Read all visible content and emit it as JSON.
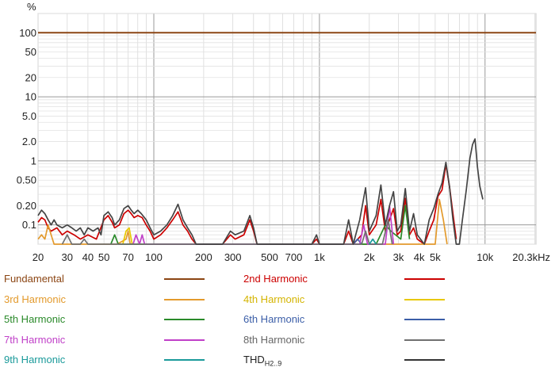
{
  "chart_data": {
    "type": "line",
    "y_unit_label": "%",
    "x_unit_label": "kHz",
    "x_scale": "log",
    "y_scale": "log",
    "xlim": [
      20,
      20300
    ],
    "ylim": [
      0.05,
      200
    ],
    "grid": true,
    "x_ticks": [
      {
        "v": 20,
        "label": "20"
      },
      {
        "v": 30,
        "label": "30"
      },
      {
        "v": 40,
        "label": "40"
      },
      {
        "v": 50,
        "label": "50"
      },
      {
        "v": 70,
        "label": "70"
      },
      {
        "v": 100,
        "label": "100"
      },
      {
        "v": 200,
        "label": "200"
      },
      {
        "v": 300,
        "label": "300"
      },
      {
        "v": 500,
        "label": "500"
      },
      {
        "v": 700,
        "label": "700"
      },
      {
        "v": 1000,
        "label": "1k"
      },
      {
        "v": 2000,
        "label": "2k"
      },
      {
        "v": 3000,
        "label": "3k"
      },
      {
        "v": 4000,
        "label": "4k"
      },
      {
        "v": 5000,
        "label": "5k"
      },
      {
        "v": 10000,
        "label": "10k"
      },
      {
        "v": 20300,
        "label": "20.3"
      }
    ],
    "y_ticks": [
      {
        "v": 100,
        "label": "100"
      },
      {
        "v": 50,
        "label": "50"
      },
      {
        "v": 20,
        "label": "20"
      },
      {
        "v": 10,
        "label": "10"
      },
      {
        "v": 5,
        "label": "5.0"
      },
      {
        "v": 2,
        "label": "2.0"
      },
      {
        "v": 1,
        "label": "1"
      },
      {
        "v": 0.5,
        "label": "0.50"
      },
      {
        "v": 0.2,
        "label": "0.20"
      },
      {
        "v": 0.1,
        "label": "0.1"
      }
    ],
    "series": [
      {
        "name": "Fundamental",
        "color": "#8b4513",
        "points": [
          [
            20,
            100
          ],
          [
            20300,
            100
          ]
        ]
      },
      {
        "name": "2nd Harmonic",
        "color": "#cc0000",
        "points": [
          [
            20,
            0.11
          ],
          [
            21,
            0.13
          ],
          [
            22,
            0.12
          ],
          [
            23,
            0.09
          ],
          [
            24,
            0.08
          ],
          [
            26,
            0.09
          ],
          [
            28,
            0.07
          ],
          [
            30,
            0.08
          ],
          [
            33,
            0.07
          ],
          [
            36,
            0.06
          ],
          [
            40,
            0.07
          ],
          [
            45,
            0.06
          ],
          [
            50,
            0.12
          ],
          [
            53,
            0.14
          ],
          [
            56,
            0.11
          ],
          [
            58,
            0.09
          ],
          [
            62,
            0.1
          ],
          [
            66,
            0.15
          ],
          [
            70,
            0.17
          ],
          [
            73,
            0.15
          ],
          [
            76,
            0.13
          ],
          [
            80,
            0.14
          ],
          [
            85,
            0.13
          ],
          [
            90,
            0.1
          ],
          [
            95,
            0.08
          ],
          [
            100,
            0.06
          ],
          [
            110,
            0.07
          ],
          [
            120,
            0.09
          ],
          [
            130,
            0.12
          ],
          [
            140,
            0.16
          ],
          [
            150,
            0.1
          ],
          [
            160,
            0.08
          ],
          [
            170,
            0.06
          ],
          [
            180,
            0.05
          ],
          [
            260,
            0.05
          ],
          [
            290,
            0.07
          ],
          [
            310,
            0.06
          ],
          [
            350,
            0.07
          ],
          [
            380,
            0.12
          ],
          [
            400,
            0.08
          ],
          [
            420,
            0.05
          ],
          [
            900,
            0.05
          ],
          [
            960,
            0.06
          ],
          [
            1000,
            0.05
          ],
          [
            1400,
            0.05
          ],
          [
            1500,
            0.08
          ],
          [
            1600,
            0.05
          ],
          [
            1800,
            0.07
          ],
          [
            1900,
            0.2
          ],
          [
            2000,
            0.07
          ],
          [
            2200,
            0.1
          ],
          [
            2350,
            0.25
          ],
          [
            2500,
            0.08
          ],
          [
            2650,
            0.12
          ],
          [
            2800,
            0.18
          ],
          [
            2950,
            0.07
          ],
          [
            3100,
            0.08
          ],
          [
            3300,
            0.26
          ],
          [
            3500,
            0.07
          ],
          [
            3700,
            0.09
          ],
          [
            3900,
            0.06
          ],
          [
            4300,
            0.05
          ],
          [
            4600,
            0.08
          ],
          [
            4900,
            0.12
          ],
          [
            5200,
            0.28
          ],
          [
            5500,
            0.35
          ],
          [
            5800,
            0.88
          ],
          [
            6100,
            0.4
          ],
          [
            6400,
            0.15
          ],
          [
            6700,
            0.06
          ]
        ]
      },
      {
        "name": "3rd Harmonic",
        "color": "#e39a2c",
        "points": [
          [
            20,
            0.06
          ],
          [
            21,
            0.07
          ],
          [
            22,
            0.06
          ],
          [
            23,
            0.1
          ],
          [
            24,
            0.07
          ],
          [
            25,
            0.05
          ],
          [
            60,
            0.05
          ],
          [
            68,
            0.06
          ],
          [
            70,
            0.08
          ],
          [
            72,
            0.05
          ],
          [
            5000,
            0.05
          ],
          [
            5300,
            0.25
          ],
          [
            5600,
            0.12
          ],
          [
            5900,
            0.05
          ]
        ]
      },
      {
        "name": "4th Harmonic",
        "color": "#e8c800",
        "points": [
          [
            65,
            0.05
          ],
          [
            68,
            0.08
          ],
          [
            71,
            0.09
          ],
          [
            74,
            0.05
          ]
        ]
      },
      {
        "name": "5th Harmonic",
        "color": "#2a8a2a",
        "points": [
          [
            55,
            0.05
          ],
          [
            58,
            0.07
          ],
          [
            61,
            0.05
          ],
          [
            2200,
            0.05
          ],
          [
            2500,
            0.1
          ],
          [
            2700,
            0.08
          ],
          [
            3100,
            0.06
          ],
          [
            3300,
            0.2
          ],
          [
            3500,
            0.06
          ]
        ]
      },
      {
        "name": "6th Harmonic",
        "color": "#3b5ea8",
        "points": [
          [
            1600,
            0.05
          ],
          [
            1700,
            0.06
          ],
          [
            1800,
            0.05
          ]
        ]
      },
      {
        "name": "7th Harmonic",
        "color": "#c040c8",
        "points": [
          [
            75,
            0.05
          ],
          [
            78,
            0.07
          ],
          [
            82,
            0.05
          ],
          [
            85,
            0.07
          ],
          [
            88,
            0.05
          ],
          [
            1750,
            0.05
          ],
          [
            1850,
            0.1
          ],
          [
            1950,
            0.05
          ],
          [
            2500,
            0.05
          ],
          [
            2650,
            0.2
          ],
          [
            2800,
            0.05
          ]
        ]
      },
      {
        "name": "8th Harmonic",
        "color": "#707070",
        "points": [
          [
            28,
            0.05
          ],
          [
            30,
            0.07
          ],
          [
            32,
            0.05
          ],
          [
            36,
            0.05
          ],
          [
            38,
            0.06
          ],
          [
            40,
            0.05
          ],
          [
            1800,
            0.05
          ],
          [
            1900,
            0.08
          ],
          [
            2000,
            0.05
          ],
          [
            2400,
            0.05
          ],
          [
            2600,
            0.12
          ],
          [
            2750,
            0.05
          ]
        ]
      },
      {
        "name": "9th Harmonic",
        "color": "#1a9a9a",
        "points": [
          [
            2000,
            0.05
          ],
          [
            2100,
            0.06
          ],
          [
            2200,
            0.05
          ]
        ]
      },
      {
        "name": "THD",
        "color": "#444444",
        "points": [
          [
            20,
            0.14
          ],
          [
            21,
            0.17
          ],
          [
            22,
            0.15
          ],
          [
            23,
            0.12
          ],
          [
            24,
            0.1
          ],
          [
            25,
            0.12
          ],
          [
            26,
            0.1
          ],
          [
            28,
            0.09
          ],
          [
            30,
            0.1
          ],
          [
            32,
            0.09
          ],
          [
            34,
            0.08
          ],
          [
            36,
            0.09
          ],
          [
            38,
            0.07
          ],
          [
            40,
            0.09
          ],
          [
            43,
            0.08
          ],
          [
            46,
            0.09
          ],
          [
            48,
            0.07
          ],
          [
            50,
            0.14
          ],
          [
            53,
            0.16
          ],
          [
            56,
            0.13
          ],
          [
            58,
            0.1
          ],
          [
            62,
            0.12
          ],
          [
            66,
            0.18
          ],
          [
            70,
            0.2
          ],
          [
            73,
            0.17
          ],
          [
            76,
            0.15
          ],
          [
            80,
            0.17
          ],
          [
            84,
            0.15
          ],
          [
            90,
            0.12
          ],
          [
            95,
            0.09
          ],
          [
            100,
            0.07
          ],
          [
            110,
            0.08
          ],
          [
            120,
            0.1
          ],
          [
            130,
            0.14
          ],
          [
            140,
            0.21
          ],
          [
            150,
            0.12
          ],
          [
            160,
            0.09
          ],
          [
            170,
            0.07
          ],
          [
            180,
            0.05
          ],
          [
            260,
            0.05
          ],
          [
            290,
            0.08
          ],
          [
            310,
            0.07
          ],
          [
            350,
            0.08
          ],
          [
            380,
            0.14
          ],
          [
            400,
            0.09
          ],
          [
            420,
            0.05
          ],
          [
            900,
            0.05
          ],
          [
            960,
            0.07
          ],
          [
            1000,
            0.05
          ],
          [
            1400,
            0.05
          ],
          [
            1500,
            0.12
          ],
          [
            1600,
            0.05
          ],
          [
            1750,
            0.12
          ],
          [
            1900,
            0.38
          ],
          [
            2000,
            0.08
          ],
          [
            2200,
            0.14
          ],
          [
            2350,
            0.42
          ],
          [
            2500,
            0.1
          ],
          [
            2650,
            0.2
          ],
          [
            2800,
            0.33
          ],
          [
            2950,
            0.08
          ],
          [
            3100,
            0.1
          ],
          [
            3300,
            0.37
          ],
          [
            3500,
            0.08
          ],
          [
            3700,
            0.15
          ],
          [
            3900,
            0.07
          ],
          [
            4300,
            0.05
          ],
          [
            4600,
            0.12
          ],
          [
            4900,
            0.18
          ],
          [
            5200,
            0.3
          ],
          [
            5500,
            0.45
          ],
          [
            5800,
            0.95
          ],
          [
            6100,
            0.4
          ],
          [
            6400,
            0.12
          ],
          [
            6700,
            0.05
          ],
          [
            7000,
            0.05
          ],
          [
            7300,
            0.12
          ],
          [
            7700,
            0.35
          ],
          [
            8100,
            1.1
          ],
          [
            8400,
            1.8
          ],
          [
            8700,
            2.2
          ],
          [
            9000,
            0.8
          ],
          [
            9300,
            0.4
          ],
          [
            9700,
            0.25
          ]
        ]
      }
    ]
  },
  "legend": [
    {
      "label": "Fundamental",
      "label_color": "#8b4513",
      "line_color": "#8b4513"
    },
    {
      "label": "2nd Harmonic",
      "label_color": "#cc0000",
      "line_color": "#cc0000"
    },
    {
      "label": "3rd Harmonic",
      "label_color": "#e39a2c",
      "line_color": "#e39a2c"
    },
    {
      "label": "4th Harmonic",
      "label_color": "#d4b400",
      "line_color": "#e8c800"
    },
    {
      "label": "5th Harmonic",
      "label_color": "#2a8a2a",
      "line_color": "#2a8a2a"
    },
    {
      "label": "6th Harmonic",
      "label_color": "#3b5ea8",
      "line_color": "#3b5ea8"
    },
    {
      "label": "7th Harmonic",
      "label_color": "#c040c8",
      "line_color": "#c040c8"
    },
    {
      "label": "8th Harmonic",
      "label_color": "#666666",
      "line_color": "#707070"
    },
    {
      "label": "9th Harmonic",
      "label_color": "#1a9a9a",
      "line_color": "#1a9a9a"
    },
    {
      "label": "THD",
      "sub": "H2..9",
      "label_color": "#222222",
      "line_color": "#333333"
    }
  ]
}
